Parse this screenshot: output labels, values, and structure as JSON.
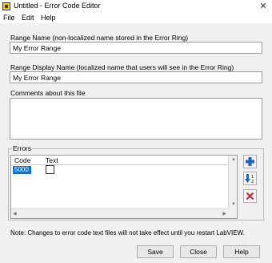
{
  "window": {
    "title": "Untitled - Error Code Editor",
    "close_glyph": "✕"
  },
  "menu": {
    "file": "File",
    "edit": "Edit",
    "help": "Help"
  },
  "range_name": {
    "label": "Range Name (non-localized name stored in the Error Ring)",
    "value": "My Error Range"
  },
  "range_display_name": {
    "label": "Range Display Name (localized name that users will see in the Error Ring)",
    "value": "My Error Range"
  },
  "comments": {
    "label": "Comments about this file",
    "value": ""
  },
  "errors": {
    "label": "Errors",
    "columns": {
      "code": "Code",
      "text": "Text"
    },
    "rows": [
      {
        "code": "5000",
        "checked": false
      }
    ]
  },
  "side_buttons": {
    "add_icon": "plus-icon",
    "sort_icon": "sort-icon",
    "delete_icon": "delete-icon"
  },
  "note": "Note: Changes to error code text files will not take effect until you restart LabVIEW.",
  "buttons": {
    "save": "Save",
    "close": "Close",
    "help": "Help"
  },
  "colors": {
    "selection": "#0a72d4",
    "add": "#1f63c8",
    "delete": "#d9232a"
  }
}
